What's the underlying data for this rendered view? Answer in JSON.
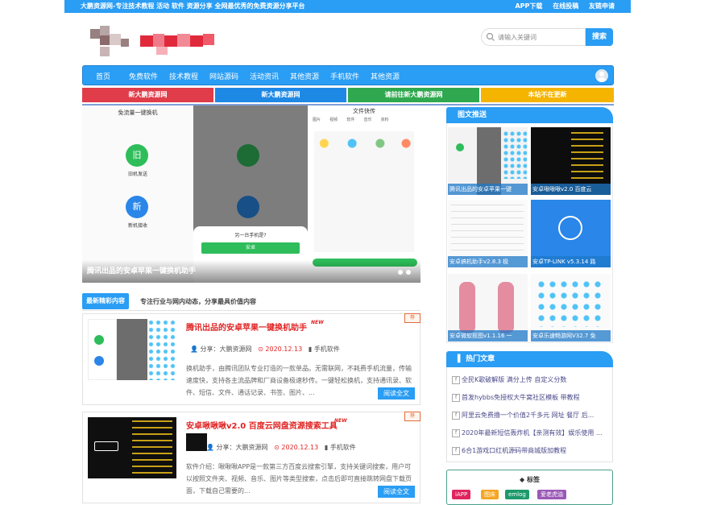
{
  "topbar": {
    "title": "大鹏资源网-专注技术教程 活动 软件 资源分享 全网最优秀的免费资源分享平台",
    "links": [
      "APP下载",
      "在线投稿",
      "友链申请"
    ]
  },
  "search": {
    "placeholder": "请输入关键词",
    "button": "搜索"
  },
  "nav": {
    "items": [
      "首页",
      "免费软件",
      "技术教程",
      "网站源码",
      "活动资讯",
      "其他资源",
      "手机软件",
      "其他资源"
    ]
  },
  "banners": [
    {
      "label": "新大鹏资源网",
      "color": "#e03c4a"
    },
    {
      "label": "新大鹏资源网",
      "color": "#1e88e5"
    },
    {
      "label": "请前往新大鹏资源网",
      "color": "#2fa84f"
    },
    {
      "label": "本站不在更新",
      "color": "#f5b400"
    }
  ],
  "slider": {
    "caption": "腾讯出品的安卓苹果一键换机助手",
    "phone1": {
      "title": "免流量一键换机",
      "btn1": "旧机发送",
      "btn2": "新机接收",
      "g1": "旧",
      "g2": "新"
    },
    "phone3": {
      "title": "文件快传",
      "tabs": [
        "图片",
        "视频",
        "软件",
        "音乐",
        "资料"
      ]
    },
    "dialog": {
      "title": "另一台手机是?",
      "opt1": "安卓"
    }
  },
  "section": {
    "tag": "最新精彩内容",
    "subtitle": "专注行业与网内动态，分享最具价值内容"
  },
  "articles": [
    {
      "title": "腾讯出品的安卓苹果一键换机助手",
      "new": "NEW",
      "rec": "荐",
      "author": "分享：大鹏资源网",
      "date": "2020.12.13",
      "category": "手机软件",
      "body": "换机助手，由腾讯团队专业打造的一款单品。无需联网，不耗费手机流量，传输速度快，支持各主流品牌和厂商设备极速秒传。一键轻松换机，支持通讯录、软件、短信、文件、通话记录、书签、图片、...",
      "more": "阅读全文"
    },
    {
      "title": "安卓啾啾啾v2.0 百度云网盘资源搜索工具",
      "new": "NEW",
      "rec": "荐",
      "author": "分享：大鹏资源网",
      "date": "2020.12.13",
      "category": "手机软件",
      "body": "软件介绍：啾啾啾APP是一款第三方百度云搜索引擎，支持关键词搜索，用户可以按照文件夹、视频、音乐、图片等类型搜索，点击后即可直接跳转网盘下载页面，下载自己需要的...",
      "more": "阅读全文"
    }
  ],
  "sidebar": {
    "image_head": "图文推送",
    "image_posts": [
      "腾讯出品的安卓苹果一键",
      "安卓啾啾啾v2.0 百度云",
      "安卓搞机助手v2.8.3 极",
      "安卓TP-LINK v5.3.14 路",
      "安卓微软抠图v1.1.16 一",
      "安卓乐速畅游网V32.7 免"
    ],
    "hot_head": "热门文章",
    "hot": [
      "全民K歌破解版 满分上传 自定义分数",
      "首发hybbs免授权大牛窝社区模板 带教程",
      "阿里云免费撸一个价值2千多元 网址 餐厅 后...",
      "2020年最新短信轰炸机【亲测有效】娱乐使用 ...",
      "6合1游戏口红机源码带商城版加教程"
    ],
    "tags_head": "标签",
    "tags": [
      {
        "label": "iAPP",
        "color": "#e0245e"
      },
      {
        "label": "图床",
        "color": "#f5a623"
      },
      {
        "label": "emlog",
        "color": "#1d9a6c"
      },
      {
        "label": "爱老虎油",
        "color": "#9b59b6"
      }
    ]
  }
}
